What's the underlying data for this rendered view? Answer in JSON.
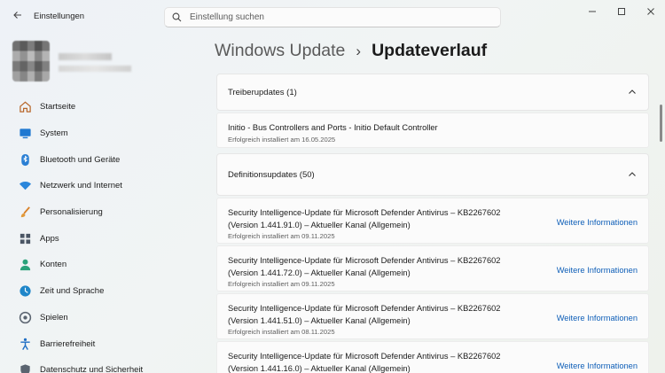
{
  "titlebar": {
    "app_title": "Einstellungen",
    "search_placeholder": "Einstellung suchen"
  },
  "sidebar": {
    "items": [
      {
        "label": "Startseite",
        "icon": "home-icon"
      },
      {
        "label": "System",
        "icon": "monitor-icon"
      },
      {
        "label": "Bluetooth und Geräte",
        "icon": "bluetooth-icon"
      },
      {
        "label": "Netzwerk und Internet",
        "icon": "wifi-icon"
      },
      {
        "label": "Personalisierung",
        "icon": "brush-icon"
      },
      {
        "label": "Apps",
        "icon": "apps-icon"
      },
      {
        "label": "Konten",
        "icon": "person-icon"
      },
      {
        "label": "Zeit und Sprache",
        "icon": "globe-clock-icon"
      },
      {
        "label": "Spielen",
        "icon": "gamepad-icon"
      },
      {
        "label": "Barrierefreiheit",
        "icon": "accessibility-icon"
      },
      {
        "label": "Datenschutz und Sicherheit",
        "icon": "shield-icon"
      }
    ]
  },
  "main": {
    "breadcrumb": {
      "parent": "Windows Update",
      "separator": "›",
      "current": "Updateverlauf"
    },
    "driver_section": {
      "title": "Treiberupdates (1)",
      "entries": [
        {
          "title": "Initio - Bus Controllers and Ports - Initio Default Controller",
          "status": "Erfolgreich installiert am 16.05.2025"
        }
      ]
    },
    "definition_section": {
      "title": "Definitionsupdates (50)",
      "link_label": "Weitere Informationen",
      "entries": [
        {
          "title_line1": "Security Intelligence-Update für Microsoft Defender Antivirus – KB2267602",
          "title_line2": "(Version 1.441.91.0) – Aktueller Kanal (Allgemein)",
          "status": "Erfolgreich installiert am 09.11.2025"
        },
        {
          "title_line1": "Security Intelligence-Update für Microsoft Defender Antivirus – KB2267602",
          "title_line2": "(Version 1.441.72.0) – Aktueller Kanal (Allgemein)",
          "status": "Erfolgreich installiert am 09.11.2025"
        },
        {
          "title_line1": "Security Intelligence-Update für Microsoft Defender Antivirus – KB2267602",
          "title_line2": "(Version 1.441.51.0) – Aktueller Kanal (Allgemein)",
          "status": "Erfolgreich installiert am 08.11.2025"
        },
        {
          "title_line1": "Security Intelligence-Update für Microsoft Defender Antivirus – KB2267602",
          "title_line2": "(Version 1.441.16.0) – Aktueller Kanal (Allgemein)",
          "status": ""
        }
      ]
    }
  },
  "colors": {
    "link": "#0f5fb8",
    "card_bg": "#fbfbfb",
    "accent": "#0067c0"
  }
}
